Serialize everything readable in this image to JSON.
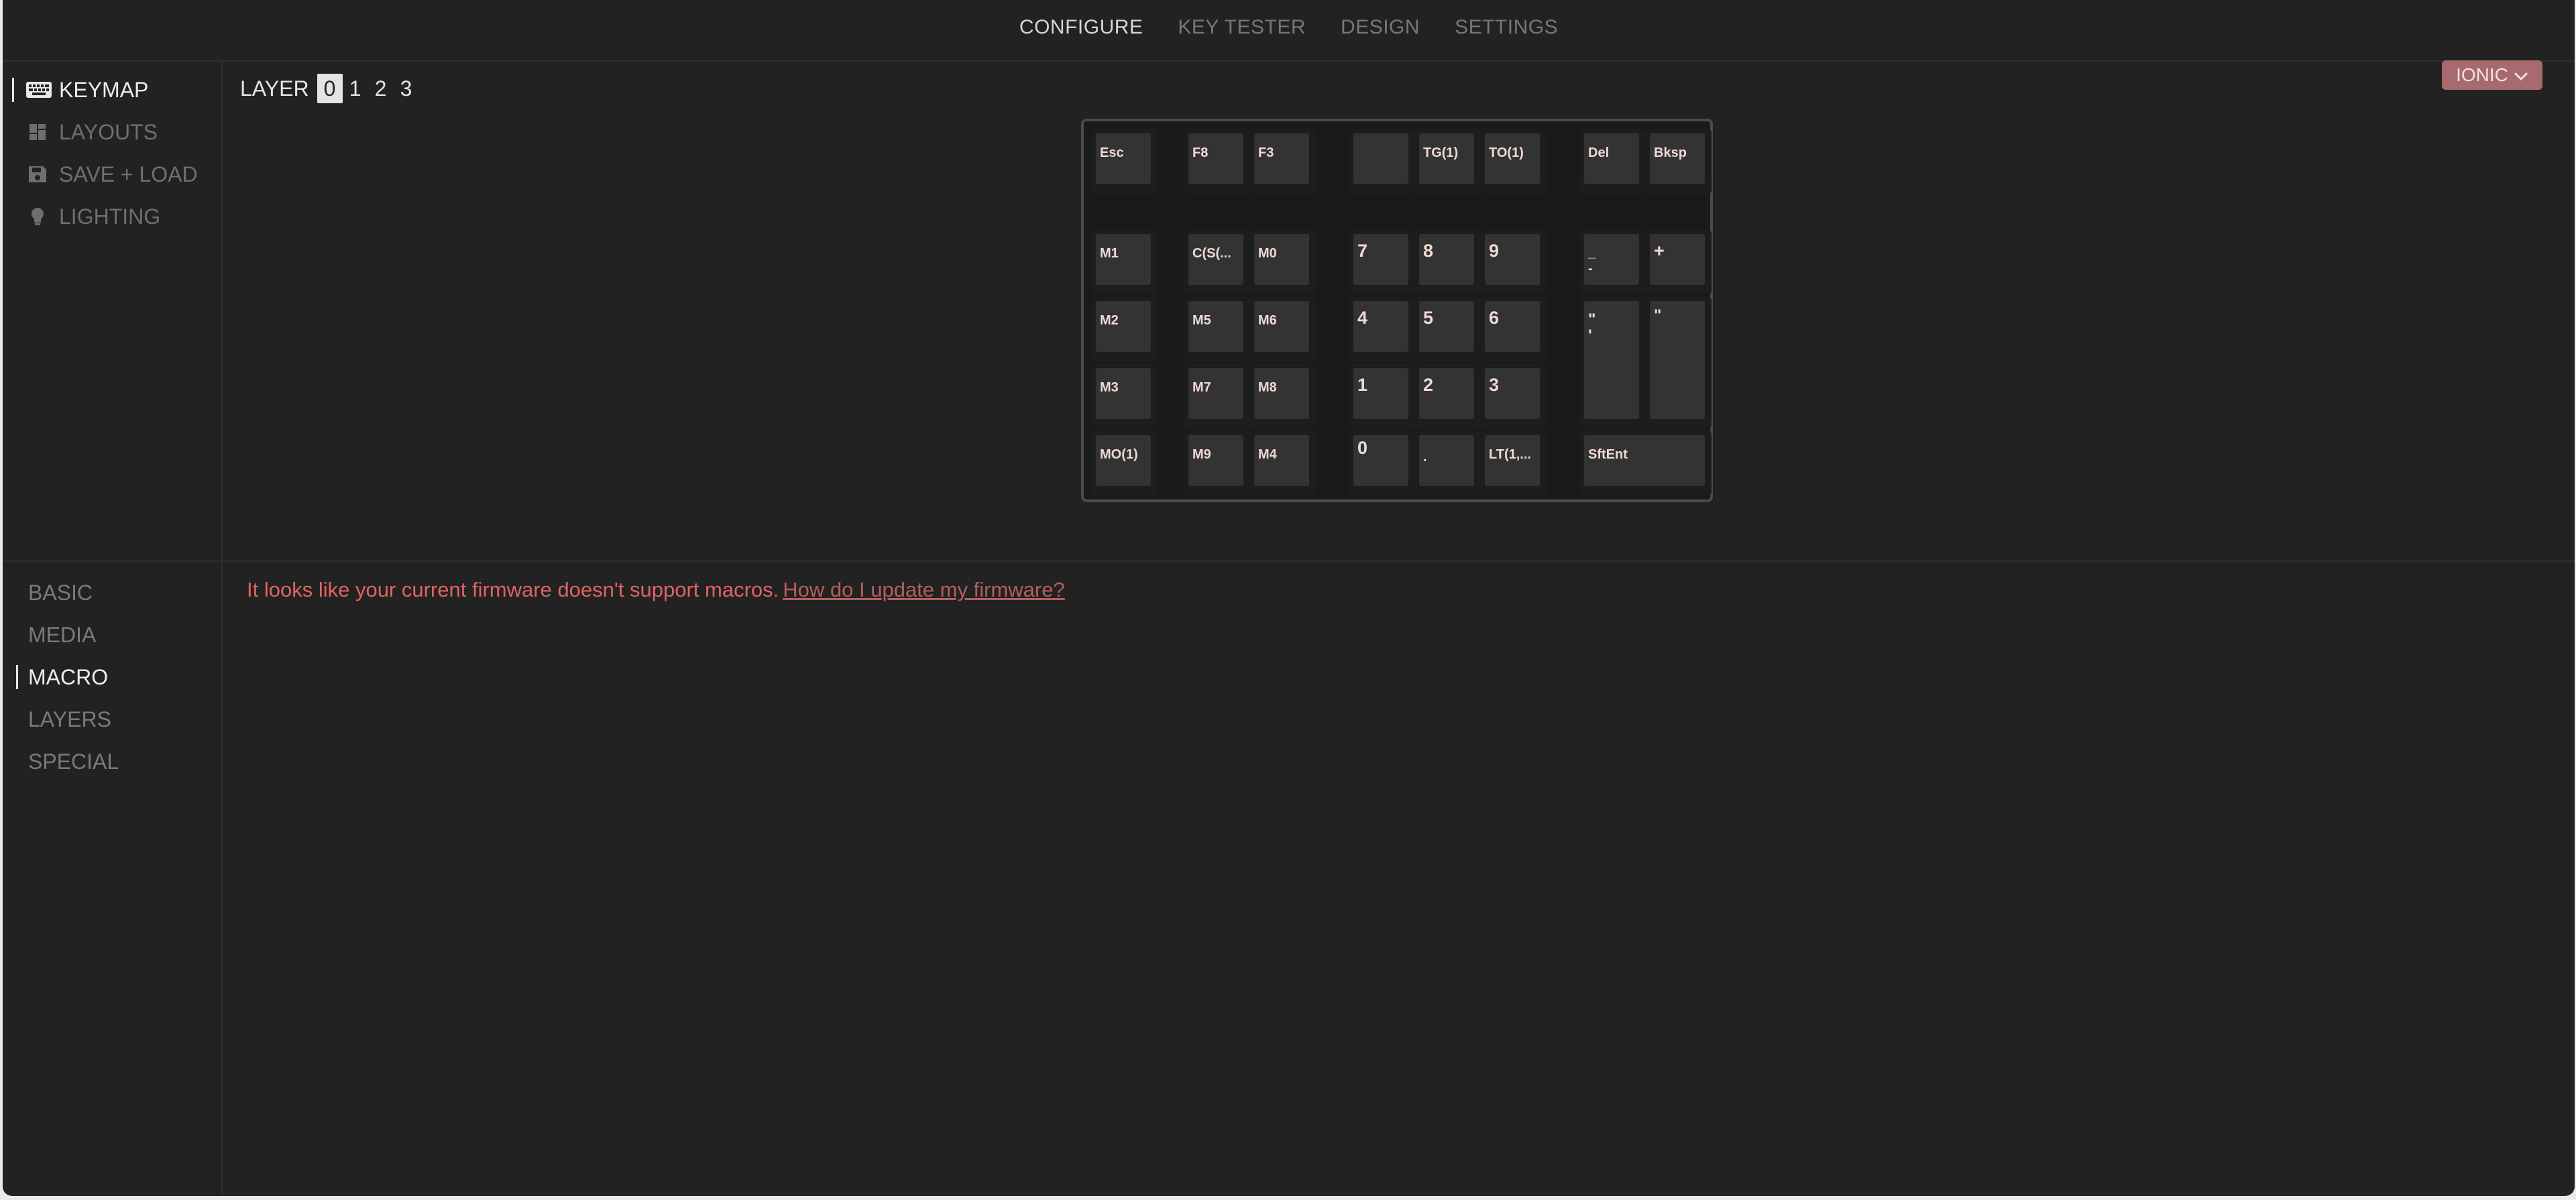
{
  "nav": {
    "tabs": [
      {
        "label": "CONFIGURE",
        "active": true
      },
      {
        "label": "KEY TESTER",
        "active": false
      },
      {
        "label": "DESIGN",
        "active": false
      },
      {
        "label": "SETTINGS",
        "active": false
      }
    ]
  },
  "keyboard_select": {
    "label": "IONIC",
    "icon": "chevron-down-icon"
  },
  "side_menu": {
    "items": [
      {
        "label": "KEYMAP",
        "icon": "keyboard-icon",
        "active": true
      },
      {
        "label": "LAYOUTS",
        "icon": "layout-grid-icon",
        "active": false
      },
      {
        "label": "SAVE + LOAD",
        "icon": "floppy-disk-icon",
        "active": false
      },
      {
        "label": "LIGHTING",
        "icon": "lightbulb-icon",
        "active": false
      }
    ]
  },
  "layer": {
    "label": "LAYER",
    "options": [
      "0",
      "1",
      "2",
      "3"
    ],
    "selected": "0"
  },
  "keys": {
    "r0": [
      "Esc",
      "F8",
      "F3",
      "",
      "TG(1)",
      "TO(1)",
      "Del",
      "Bksp"
    ],
    "r1": [
      "M1",
      "C(S(...",
      "M0",
      "7",
      "8",
      "9",
      "_\n-",
      "+"
    ],
    "r2": [
      "M2",
      "M5",
      "M6",
      "4",
      "5",
      "6",
      "\"\n'",
      "\""
    ],
    "r3": [
      "M3",
      "M7",
      "M8",
      "1",
      "2",
      "3"
    ],
    "r4": [
      "MO(1)",
      "M9",
      "M4",
      "0",
      ".",
      "LT(1,...",
      "SftEnt"
    ]
  },
  "key_categories": {
    "items": [
      {
        "label": "BASIC",
        "active": false
      },
      {
        "label": "MEDIA",
        "active": false
      },
      {
        "label": "MACRO",
        "active": true
      },
      {
        "label": "LAYERS",
        "active": false
      },
      {
        "label": "SPECIAL",
        "active": false
      }
    ]
  },
  "macro_message": {
    "text": "It looks like your current firmware doesn't support macros.",
    "link": "How do I update my firmware?"
  },
  "colors": {
    "background": "#222222",
    "accent": "#a76a6d",
    "error_text": "#e06363",
    "keycap": "#333333",
    "keycap_text": "#f0d9d5"
  }
}
